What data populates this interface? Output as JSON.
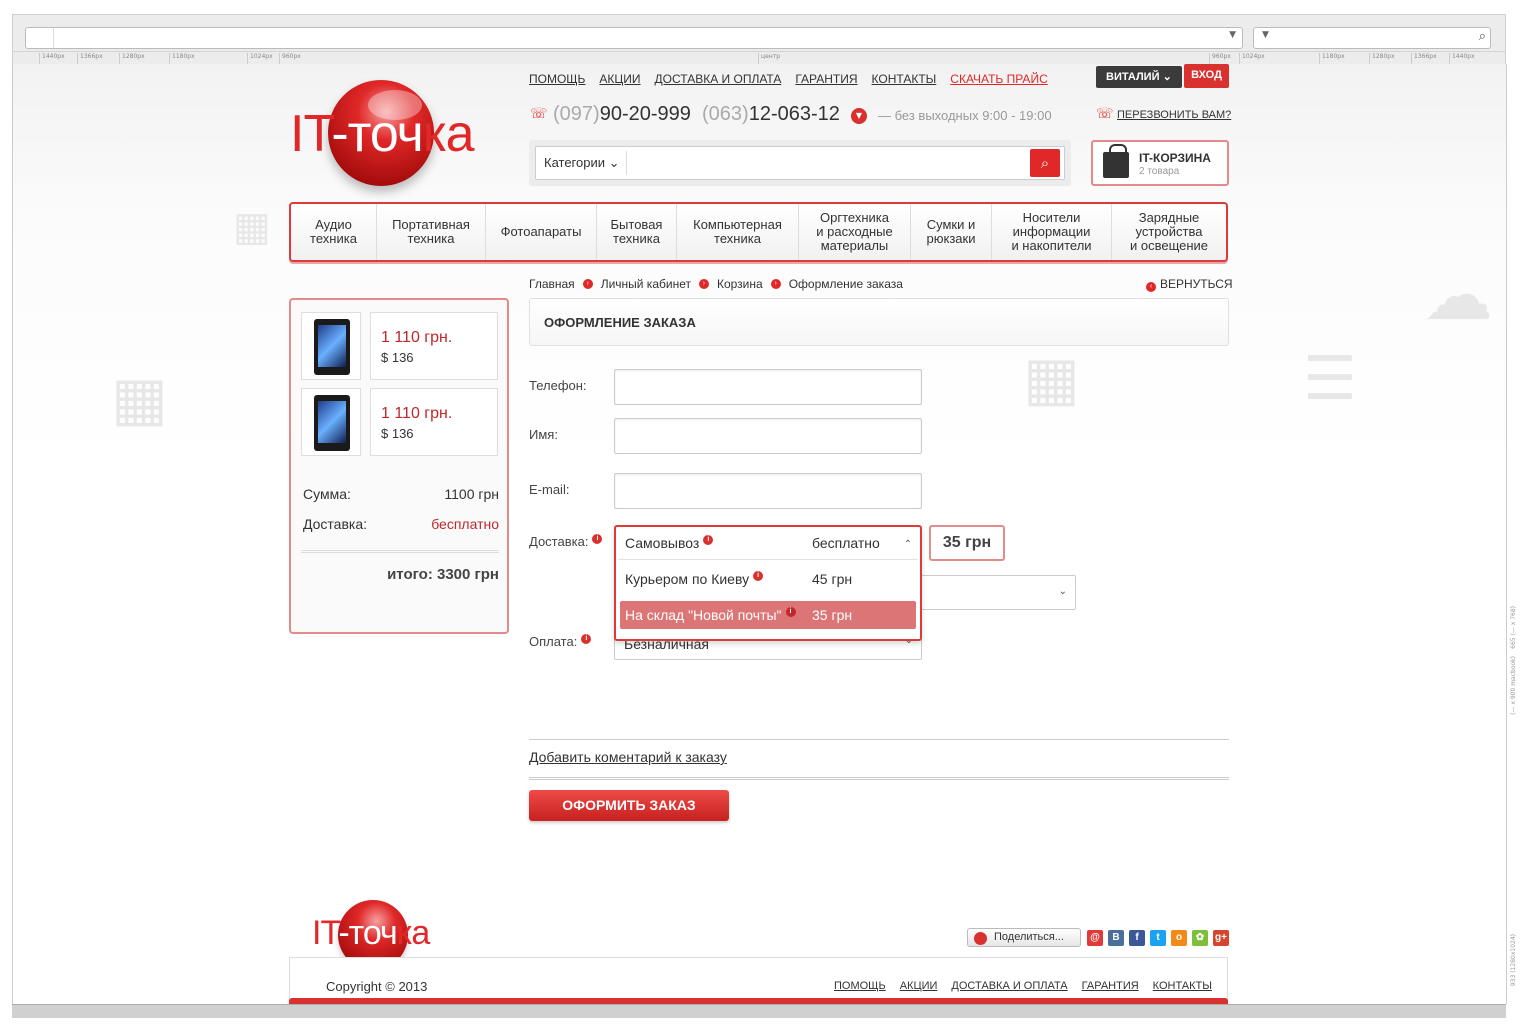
{
  "browser": {
    "ruler_left": [
      "1440px",
      "1366px",
      "1280px",
      "1180px",
      "1024px",
      "960px"
    ],
    "ruler_center": "центр",
    "ruler_right": [
      "960px",
      "1024px",
      "1180px",
      "1280px",
      "1366px",
      "1440px"
    ],
    "side_note_1": "665 (— x 768)",
    "side_note_2": "(— x 900 macbook)",
    "side_note_3": "933 (1280x1024)"
  },
  "header": {
    "logo_red": "IT",
    "logo_white": "-точ",
    "logo_red_end": "ка",
    "top_menu": [
      {
        "label": "ПОМОЩЬ"
      },
      {
        "label": "АКЦИИ"
      },
      {
        "label": "ДОСТАВКА И ОПЛАТА"
      },
      {
        "label": "ГАРАНТИЯ"
      },
      {
        "label": "КОНТАКТЫ"
      },
      {
        "label": "СКАЧАТЬ ПРАЙС"
      }
    ],
    "user_label": "ВИТАЛИЙ",
    "login_label": "ВХОД",
    "phone1_code": "(097)",
    "phone1_number": "90-20-999",
    "phone2_code": "(063)",
    "phone2_number": "12-063-12",
    "hours": "— без выходных 9:00 - 19:00",
    "callback": "ПЕРЕЗВОНИТЬ ВАМ?",
    "search_category": "Категории",
    "cart_title": "IT-КОРЗИНА",
    "cart_count": "2 товара",
    "accent_color": "#e02828"
  },
  "nav": [
    "Аудио\nтехника",
    "Портативная\nтехника",
    "Фотоапараты",
    "Бытовая\nтехника",
    "Компьютерная\nтехника",
    "Оргтехника\nи расходные\nматериалы",
    "Сумки и\nрюкзаки",
    "Носители\nинформации\nи накопители",
    "Зарядные\nустройства\nи освещение"
  ],
  "breadcrumb": [
    "Главная",
    "Личный кабинет",
    "Корзина",
    "Оформление заказа"
  ],
  "back_label": "ВЕРНУТЬСЯ",
  "cart_panel": {
    "items": [
      {
        "price_uah": "1 110 грн.",
        "price_usd": "$ 136"
      },
      {
        "price_uah": "1 110 грн.",
        "price_usd": "$ 136"
      }
    ],
    "sum_label": "Сумма:",
    "sum_value": "1100 грн",
    "delivery_label": "Доставка:",
    "delivery_value": "бесплатно",
    "total": "итого: 3300 грн"
  },
  "form": {
    "title": "ОФОРМЛЕНИЕ ЗАКАЗА",
    "phone_label": "Телефон:",
    "name_label": "Имя:",
    "email_label": "E-mail:",
    "delivery_label": "Доставка:",
    "payment_label": "Оплата:",
    "payment_value": "Безналичная",
    "delivery_options": [
      {
        "name": "Самовывоз",
        "price": "бесплатно"
      },
      {
        "name": "Курьером по Киеву",
        "price": "45 грн"
      },
      {
        "name": "На склад \"Новой почты\"",
        "price": "35 грн"
      }
    ],
    "delivery_price": "35 грн",
    "comment_link": "Добавить коментарий к заказу",
    "submit": "ОФОРМИТЬ ЗАКАЗ"
  },
  "footer": {
    "logo_red": "IT",
    "logo_white": "-точ",
    "logo_red_end": "ка",
    "share_label": "Поделиться...",
    "copyright": "Copyright © 2013",
    "menu": [
      "ПОМОЩЬ",
      "АКЦИИ",
      "ДОСТАВКА И ОПЛАТА",
      "ГАРАНТИЯ",
      "КОНТАКТЫ"
    ]
  }
}
